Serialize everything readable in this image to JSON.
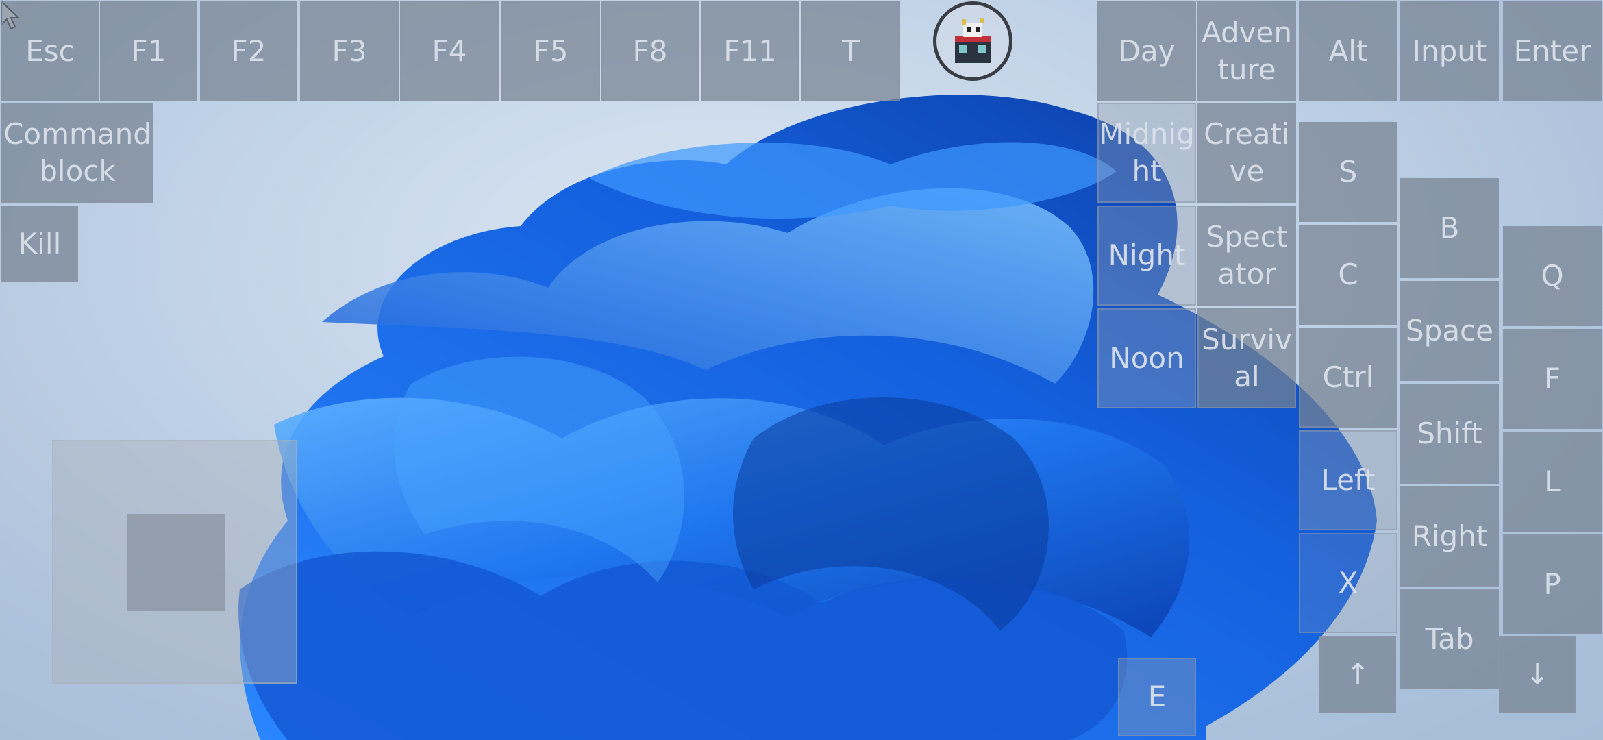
{
  "keys": {
    "esc": "Esc",
    "f1": "F1",
    "f2": "F2",
    "f3": "F3",
    "f4": "F4",
    "f5": "F5",
    "f8": "F8",
    "f11": "F11",
    "t": "T",
    "command_block": "Command\nblock",
    "kill": "Kill",
    "day": "Day",
    "adventure": "Adven\nture",
    "alt": "Alt",
    "input": "Input",
    "enter": "Enter",
    "midnight": "Midnig\nht",
    "creative": "Creati\nve",
    "s": "S",
    "b": "B",
    "night": "Night",
    "spectator": "Spect\nator",
    "c": "C",
    "q": "Q",
    "noon": "Noon",
    "survival": "Surviv\nal",
    "space": "Space",
    "ctrl": "Ctrl",
    "f": "F",
    "shift": "Shift",
    "left": "Left",
    "l": "L",
    "right": "Right",
    "x": "X",
    "p": "P",
    "tab": "Tab",
    "up": "↑",
    "down": "↓",
    "e": "E"
  },
  "icons": {
    "app": "game-app-icon",
    "cursor": "mouse-cursor-icon",
    "joystick": "virtual-joystick"
  },
  "colors": {
    "key_fill": "#76828f",
    "key_text": "#dce2ea",
    "wallpaper_bloom": "#1e6fe6"
  }
}
